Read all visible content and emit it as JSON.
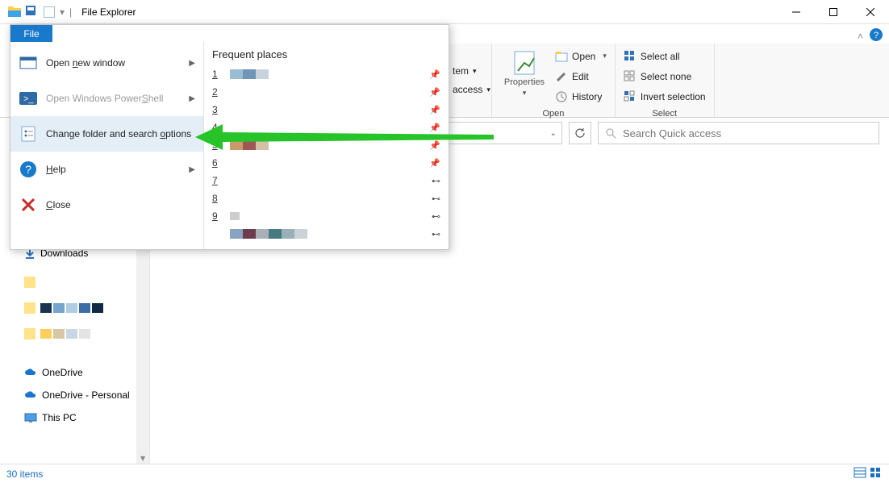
{
  "titlebar": {
    "title": "File Explorer"
  },
  "ribbon": {
    "item_fragment": "tem",
    "access_fragment": "access",
    "properties": "Properties",
    "open": "Open",
    "edit": "Edit",
    "history": "History",
    "group_open": "Open",
    "select_all": "Select all",
    "select_none": "Select none",
    "invert": "Invert selection",
    "group_select": "Select"
  },
  "search": {
    "placeholder": "Search Quick access"
  },
  "filemenu": {
    "tab": "File",
    "items": [
      {
        "label_pre": "Open ",
        "acc": "n",
        "label_post": "ew window"
      },
      {
        "label_pre": "Open Windows Power",
        "acc": "S",
        "label_post": "hell"
      },
      {
        "label_pre": "Change folder and search ",
        "acc": "o",
        "label_post": "ptions"
      },
      {
        "label_pre": "",
        "acc": "H",
        "label_post": "elp"
      },
      {
        "label_pre": "",
        "acc": "C",
        "label_post": "lose"
      }
    ],
    "frequent_title": "Frequent places",
    "frequent": [
      "1",
      "2",
      "3",
      "4",
      "5",
      "6",
      "7",
      "8",
      "9"
    ]
  },
  "nav": {
    "downloads": "Downloads",
    "onedrive": "OneDrive",
    "onedrive_personal": "OneDrive - Personal",
    "this_pc": "This PC"
  },
  "statusbar": {
    "items": "30 items"
  }
}
